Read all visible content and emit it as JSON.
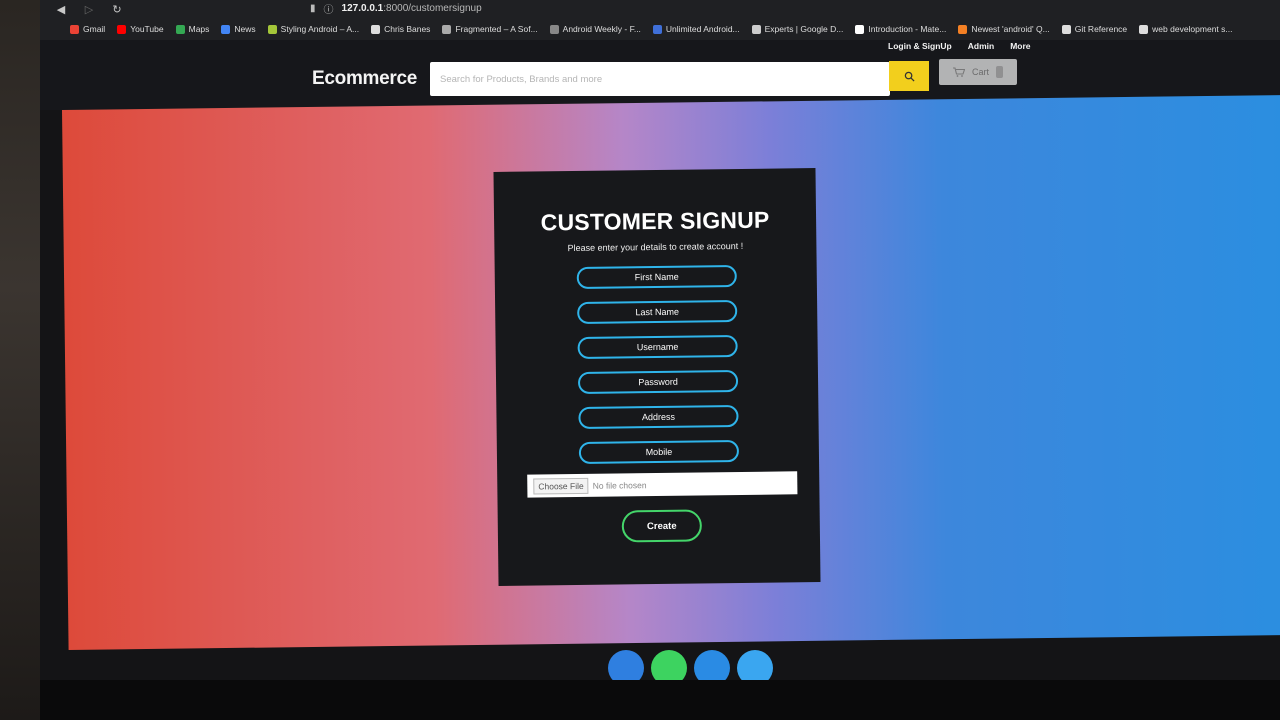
{
  "browser": {
    "url_host": "127.0.0.1",
    "url_path": ":8000/customersignup",
    "bookmarks": [
      {
        "label": "Gmail",
        "color": "#ea4335"
      },
      {
        "label": "YouTube",
        "color": "#ff0000"
      },
      {
        "label": "Maps",
        "color": "#34a853"
      },
      {
        "label": "News",
        "color": "#4285f4"
      },
      {
        "label": "Styling Android – A...",
        "color": "#a4c639"
      },
      {
        "label": "Chris Banes",
        "color": "#dddddd"
      },
      {
        "label": "Fragmented – A Sof...",
        "color": "#aaaaaa"
      },
      {
        "label": "Android Weekly - F...",
        "color": "#888888"
      },
      {
        "label": "Unlimited Android...",
        "color": "#3f6fd8"
      },
      {
        "label": "Experts | Google D...",
        "color": "#cccccc"
      },
      {
        "label": "Introduction - Mate...",
        "color": "#ffffff"
      },
      {
        "label": "Newest 'android' Q...",
        "color": "#f48024"
      },
      {
        "label": "Git Reference",
        "color": "#dddddd"
      },
      {
        "label": "web development s...",
        "color": "#dddddd"
      }
    ]
  },
  "header": {
    "brand": "Ecommerce",
    "search_placeholder": "Search for Products, Brands and more",
    "links": [
      "Login & SignUp",
      "Admin",
      "More"
    ],
    "cart_label": "Cart",
    "search_color": "#f2cf1d"
  },
  "signup": {
    "title": "CUSTOMER SIGNUP",
    "subtitle": "Please enter your details to create account !",
    "fields": [
      "First Name",
      "Last Name",
      "Username",
      "Password",
      "Address",
      "Mobile"
    ],
    "file_button": "Choose File",
    "file_status": "No file chosen",
    "submit": "Create"
  },
  "footer": {
    "social_colors": [
      "#2f7fe0",
      "#3dd360",
      "#2a8be4",
      "#3aa6f0"
    ]
  }
}
